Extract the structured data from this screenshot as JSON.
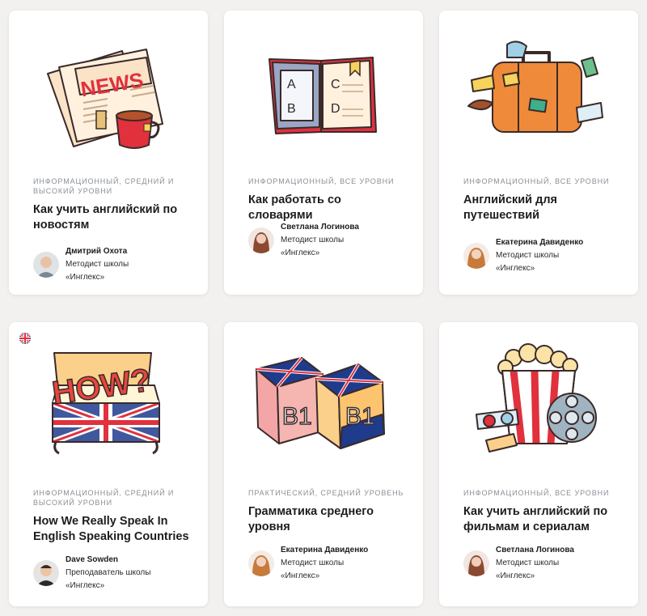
{
  "cards": [
    {
      "illustration": "news-paper-tea-icon",
      "meta": "Информационный, средний и высокий уровни",
      "title": "Как учить английский по новостям",
      "author": {
        "name": "Дмитрий Охота",
        "role_line1": "Методист школы",
        "role_line2": "«Инглекс»"
      }
    },
    {
      "illustration": "dictionary-book-icon",
      "meta": "Информационный, все уровни",
      "title": "Как работать со словарями",
      "author": {
        "name": "Светлана Логинова",
        "role_line1": "Методист школы",
        "role_line2": "«Инглекс»"
      }
    },
    {
      "illustration": "travel-suitcase-icon",
      "meta": "Информационный, все уровни",
      "title": "Английский для путешествий",
      "author": {
        "name": "Екатерина Давиденко",
        "role_line1": "Методист школы",
        "role_line2": "«Инглекс»"
      }
    },
    {
      "illustration": "how-chest-icon",
      "flag": "uk-flag-icon",
      "meta": "Информационный, средний и высокий уровни",
      "title": "How We Really Speak In English Speaking Countries",
      "author": {
        "name": "Dave Sowden",
        "role_line1": "Преподаватель школы",
        "role_line2": "«Инглекс»"
      }
    },
    {
      "illustration": "b1-cubes-icon",
      "meta": "Практический, средний уровень",
      "title": "Грамматика среднего уровня",
      "author": {
        "name": "Екатерина Давиденко",
        "role_line1": "Методист школы",
        "role_line2": "«Инглекс»"
      }
    },
    {
      "illustration": "popcorn-film-icon",
      "meta": "Информационный, все уровни",
      "title": "Как учить английский по фильмам и сериалам",
      "author": {
        "name": "Светлана Логинова",
        "role_line1": "Методист школы",
        "role_line2": "«Инглекс»"
      }
    }
  ],
  "illustration_text": {
    "news": "NEWS",
    "how": "HOW?",
    "cube": "B1",
    "dict_letters": [
      "A",
      "B",
      "C",
      "D"
    ]
  }
}
